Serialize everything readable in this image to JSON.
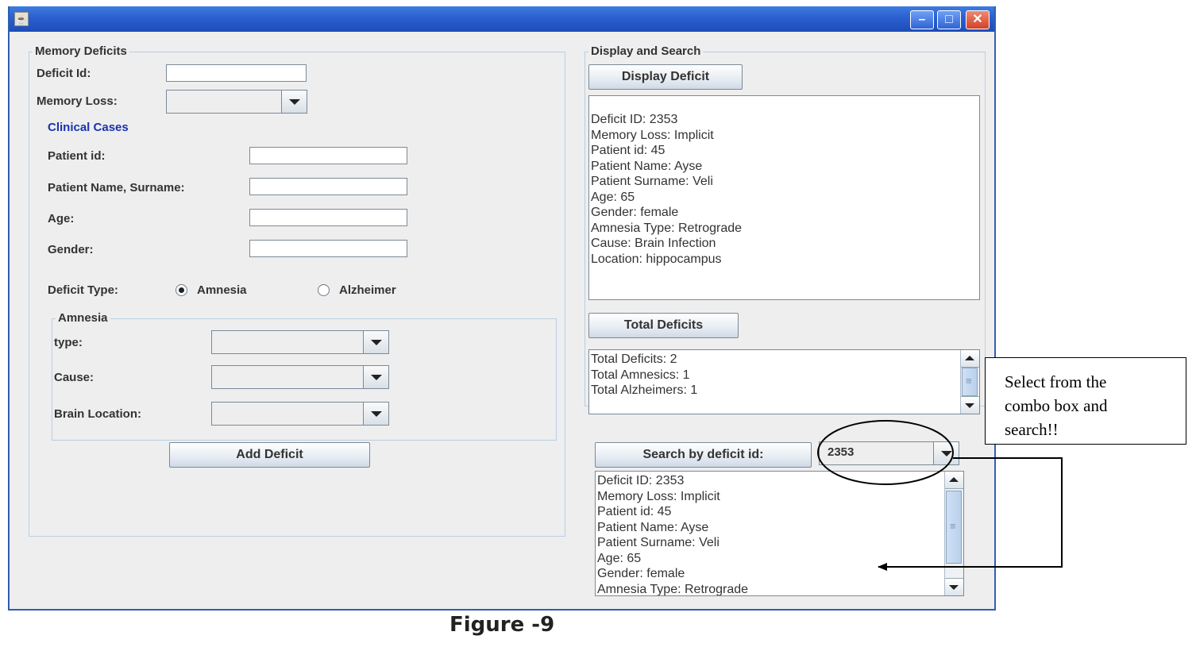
{
  "window": {
    "title": ""
  },
  "memory_deficits": {
    "title": "Memory Deficits",
    "deficit_id_label": "Deficit Id:",
    "deficit_id_value": "",
    "memory_loss_label": "Memory Loss:",
    "memory_loss_value": "",
    "clinical_cases_label": "Clinical Cases",
    "patient_id_label": "Patient id:",
    "patient_name_label": "Patient Name, Surname:",
    "age_label": "Age:",
    "gender_label": "Gender:",
    "deficit_type_label": "Deficit Type:",
    "radio_amnesia": "Amnesia",
    "radio_alzheimer": "Alzheimer",
    "selected_type": "Amnesia",
    "amnesia": {
      "title": "Amnesia",
      "type_label": "type:",
      "cause_label": "Cause:",
      "brain_location_label": "Brain Location:"
    },
    "add_button": "Add Deficit"
  },
  "display_search": {
    "title": "Display and Search",
    "display_button": "Display Deficit",
    "display_lines": [
      "Deficit ID: 2353",
      "Memory Loss: Implicit",
      "Patient id: 45",
      "Patient Name: Ayse",
      "Patient Surname: Veli",
      "Age: 65",
      "Gender: female",
      "Amnesia Type: Retrograde",
      "Cause: Brain Infection",
      "Location: hippocampus"
    ],
    "total_button": "Total Deficits",
    "total_lines": [
      "Total Deficits: 2",
      "Total Amnesics: 1",
      "Total Alzheimers: 1"
    ],
    "search_button": "Search by deficit id:",
    "search_combo_value": "2353",
    "search_lines": [
      "Deficit ID: 2353",
      "Memory Loss: Implicit",
      "Patient id: 45",
      "Patient Name: Ayse",
      "Patient Surname: Veli",
      "Age: 65",
      "Gender: female",
      "Amnesia Type: Retrograde"
    ]
  },
  "annotation": {
    "callout_line1": "Select from the",
    "callout_line2": "combo box and",
    "callout_line3": "search!!"
  },
  "caption": "Figure -9"
}
